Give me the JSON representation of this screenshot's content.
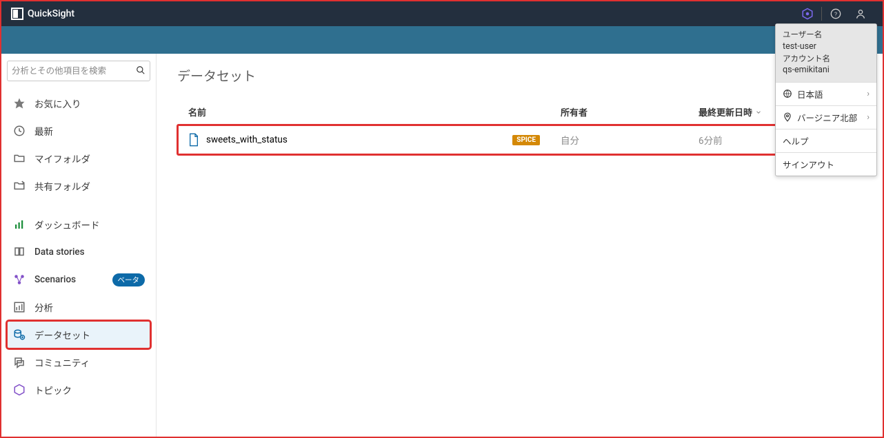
{
  "app": {
    "name": "QuickSight"
  },
  "search": {
    "placeholder": "分析とその他項目を検索"
  },
  "sidebar": {
    "favorites": "お気に入り",
    "recent": "最新",
    "my_folder": "マイフォルダ",
    "shared_folder": "共有フォルダ",
    "dashboards": "ダッシュボード",
    "data_stories": "Data stories",
    "scenarios": "Scenarios",
    "beta_badge": "ベータ",
    "analyses": "分析",
    "datasets": "データセット",
    "community": "コミュニティ",
    "topics": "トピック"
  },
  "page": {
    "title": "データセット"
  },
  "table": {
    "headers": {
      "name": "名前",
      "owner": "所有者",
      "updated": "最終更新日時"
    },
    "rows": [
      {
        "name": "sweets_with_status",
        "tag": "SPICE",
        "owner": "自分",
        "updated": "6分前"
      }
    ]
  },
  "user_menu": {
    "user_label": "ユーザー名",
    "user_value": "test-user",
    "account_label": "アカウント名",
    "account_value": "qs-emikitani",
    "language": "日本語",
    "region": "バージニア北部",
    "help": "ヘルプ",
    "signout": "サインアウト"
  }
}
